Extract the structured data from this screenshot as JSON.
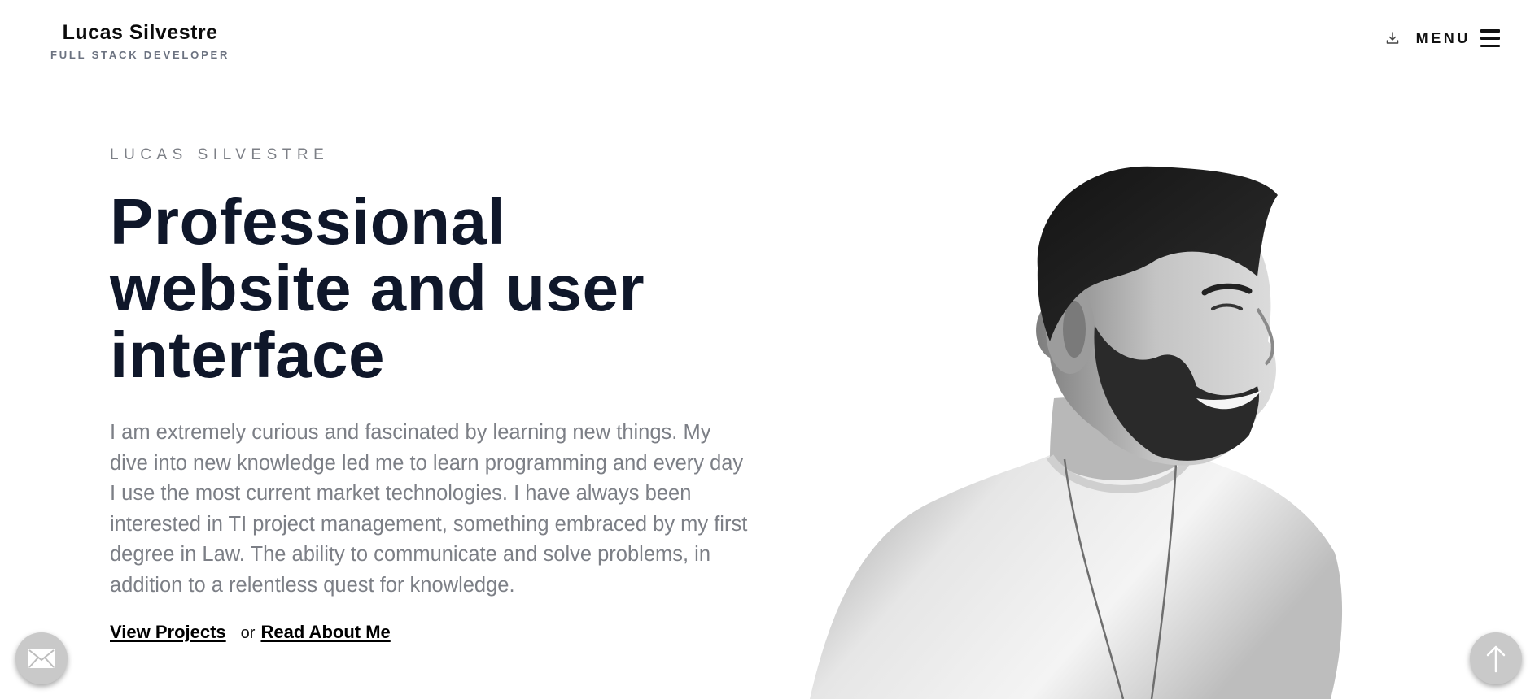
{
  "header": {
    "name": "Lucas Silvestre",
    "role": "FULL STACK DEVELOPER",
    "menu_label": "MENU",
    "download_icon": "download-icon",
    "menu_icon": "hamburger-icon"
  },
  "hero": {
    "eyebrow": "LUCAS SILVESTRE",
    "headline": "Professional\nwebsite and user\ninterface",
    "bio": "I am extremely curious and fascinated by learning new things. My dive into new knowledge led me to learn programming and every day I use the most current market technologies. I have always been interested in TI project management, something embraced by my first degree in Law. The ability to communicate and solve problems, in addition to a relentless quest for knowledge.",
    "cta_primary": "View Projects",
    "cta_separator": "or",
    "cta_secondary": "Read About Me"
  },
  "floating": {
    "contact_icon": "envelope-icon",
    "scroll_top_icon": "arrow-up-icon"
  },
  "colors": {
    "headline": "#0f172a",
    "muted_text": "#7c7f86",
    "fab": "#c9c9c9",
    "background": "#ffffff"
  }
}
